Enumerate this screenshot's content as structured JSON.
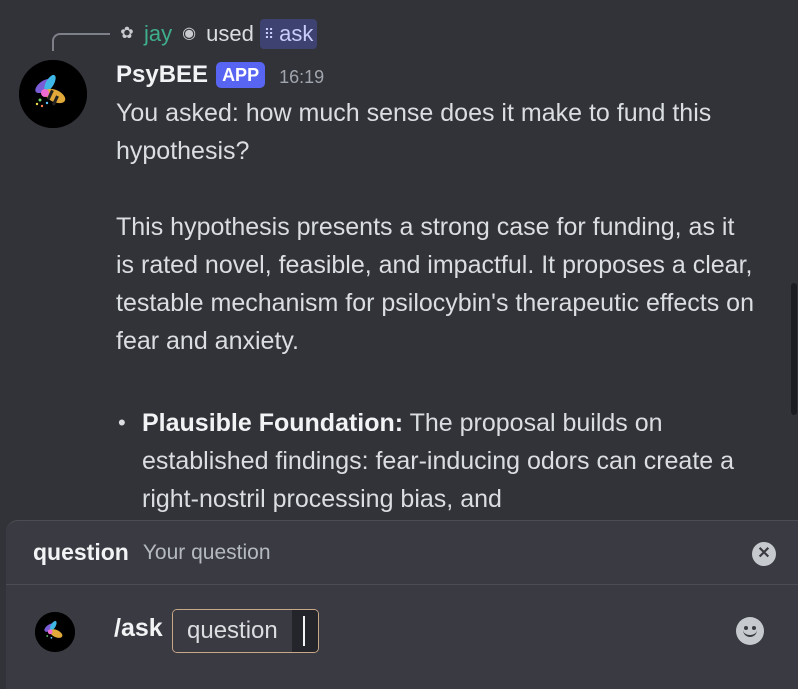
{
  "reply": {
    "user": "jay",
    "action": "used",
    "command": "ask",
    "user_icon": "bot-avatar-icon",
    "bot_icon": "robot-icon",
    "command_icon": "grid-icon"
  },
  "message": {
    "author": "PsyBEE",
    "badge": "APP",
    "timestamp": "16:19",
    "lines": [
      "You asked: how much sense does it make to fund this hypothesis?",
      "This hypothesis presents a strong case for funding, as it is rated novel, feasible, and impactful. It proposes a clear, testable mechanism for psilocybin's therapeutic effects on fear and anxiety."
    ],
    "bullet": {
      "title": "Plausible Foundation:",
      "text": " The proposal builds on established findings: fear-inducing odors can create a right-nostril processing bias, and"
    }
  },
  "composer": {
    "option_name": "question",
    "option_description": "Your question",
    "command": "/ask",
    "option_label": "question"
  },
  "colors": {
    "background": "#323339",
    "panel": "#3a3b42",
    "app_badge": "#5865f2",
    "username": "#3fae8a",
    "command_mention": "#3d4270",
    "pill_border": "#c9a889"
  }
}
